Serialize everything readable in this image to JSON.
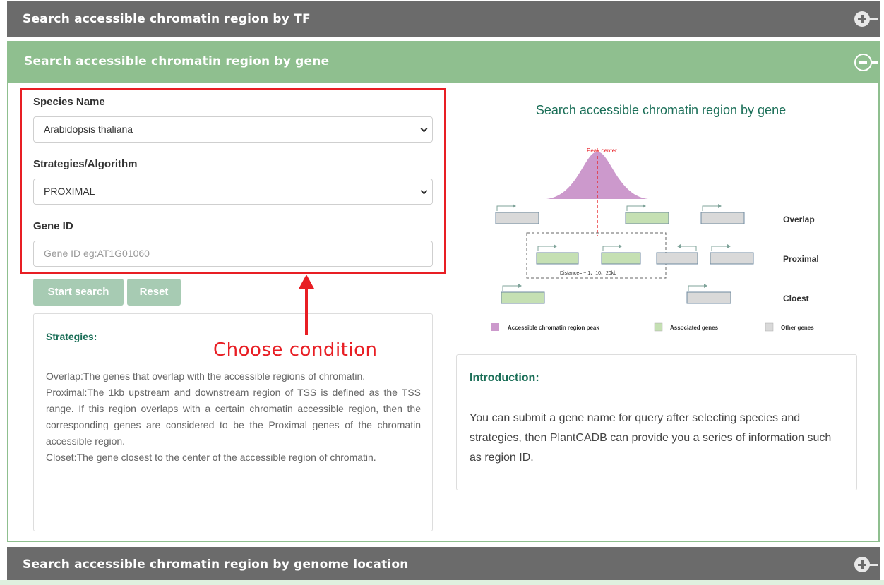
{
  "panels": {
    "tf": {
      "title": "Search accessible chromatin region by TF"
    },
    "gene": {
      "title": "Search accessible chromatin region by gene"
    },
    "location": {
      "title": "Search accessible chromatin region by genome location"
    }
  },
  "form": {
    "species_label": "Species Name",
    "species_value": "Arabidopsis thaliana",
    "strategy_label": "Strategies/Algorithm",
    "strategy_value": "PROXIMAL",
    "gene_label": "Gene ID",
    "gene_placeholder": "Gene ID   eg:AT1G01060",
    "search_button": "Start search",
    "reset_button": "Reset"
  },
  "annotation": {
    "text": "Choose condition"
  },
  "strategies": {
    "title": "Strategies:",
    "overlap": "Overlap:The genes that overlap with the accessible regions of chromatin.",
    "proximal": "Proximal:The 1kb upstream and downstream region of TSS is defined as the TSS range. If this region overlaps with a certain chromatin accessible region, then the corresponding genes are considered to be the Proximal genes of the chromatin accessible region.",
    "closest": "Closet:The gene closest to the center of the accessible region of chromatin."
  },
  "diagram": {
    "title": "Search accessible chromatin region by gene",
    "peak_label": "Peak center",
    "distance_label": "Distance= + 1、10、20kb",
    "rows": [
      "Overlap",
      "Proximal",
      "Cloest"
    ],
    "legend": [
      "Accessible chromatin region peak",
      "Associated genes",
      "Other genes"
    ],
    "colors": {
      "peak": "#cc99cc",
      "associated": "#c5e0b3",
      "other": "#d9d9d9",
      "peak_line": "#e81e24"
    }
  },
  "introduction": {
    "title": "Introduction:",
    "text": "You can submit a gene name for query after selecting species and strategies, then PlantCADB can provide you a series of information such as region ID."
  },
  "colors": {
    "panel_dark": "#6b6b6b",
    "panel_green": "#8fbf8f",
    "accent": "#1a6e57",
    "annotation": "#e81e24",
    "button": "#a7cbb3"
  }
}
